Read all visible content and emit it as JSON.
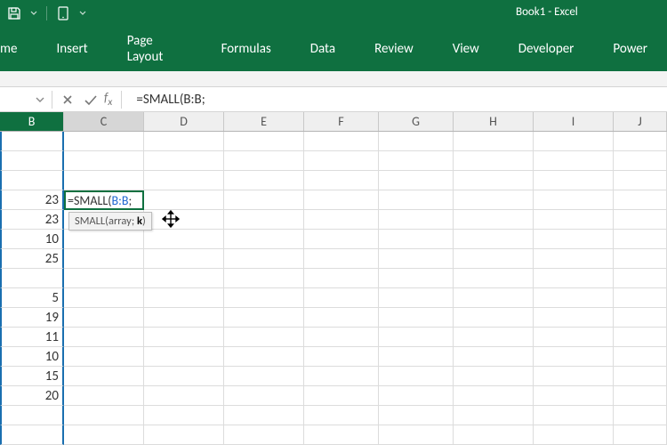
{
  "app": {
    "title": "Book1 - Excel"
  },
  "tabs": [
    "me",
    "Insert",
    "Page Layout",
    "Formulas",
    "Data",
    "Review",
    "View",
    "Developer",
    "Power"
  ],
  "formula_bar": {
    "text": "=SMALL(B:B;"
  },
  "columns": [
    "B",
    "C",
    "D",
    "E",
    "F",
    "G",
    "H",
    "I",
    "J"
  ],
  "cell_formula": {
    "fn": "=SMALL(",
    "ref": "B:B",
    "tail": ";"
  },
  "tooltip": {
    "text": "SMALL(array;",
    "bold_part": "k",
    "after": ")"
  },
  "data_b": [
    "",
    "",
    "",
    "23",
    "23",
    "10",
    "25",
    "",
    "5",
    "19",
    "11",
    "10",
    "15",
    "20"
  ]
}
